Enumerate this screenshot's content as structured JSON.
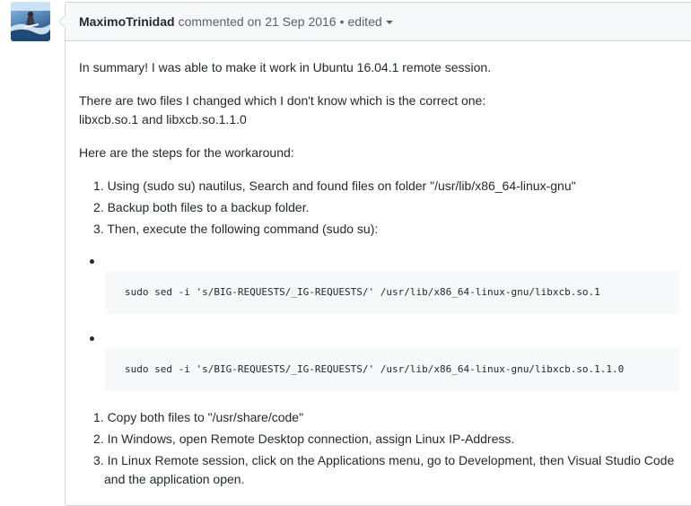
{
  "comment": {
    "author": "MaximoTrinidad",
    "action": "commented on",
    "date": "21 Sep 2016",
    "separator": "•",
    "edited": "edited",
    "paragraphs": [
      "In summary! I was able to make it work in Ubuntu 16.04.1 remote session.",
      "There are two files I changed which I don't know which is the correct one:",
      "libxcb.so.1 and libxcb.so.1.1.0",
      "Here are the steps for the workaround:"
    ],
    "steps_first": [
      "1. Using (sudo su) nautilus, Search and found files on folder \"/usr/lib/x86_64-linux-gnu\"",
      "2. Backup both files to a backup folder.",
      "3. Then, execute the following command (sudo su):"
    ],
    "code_blocks": [
      "sudo sed -i 's/BIG-REQUESTS/_IG-REQUESTS/' /usr/lib/x86_64-linux-gnu/libxcb.so.1",
      "sudo sed -i 's/BIG-REQUESTS/_IG-REQUESTS/' /usr/lib/x86_64-linux-gnu/libxcb.so.1.1.0"
    ],
    "steps_second": [
      "1. Copy both files to \"/usr/share/code\"",
      "2. In Windows, open Remote Desktop connection, assign Linux IP-Address.",
      "3. In Linux Remote session, click on the Applications menu, go to Development, then Visual Studio Code",
      "and the application open."
    ]
  }
}
